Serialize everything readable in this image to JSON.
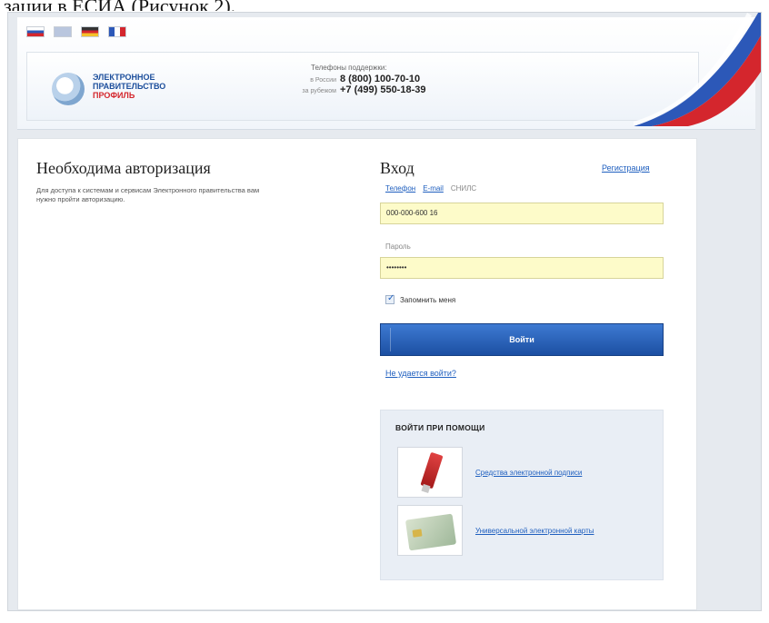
{
  "doc_caption": "зации в ЕСИА (Рисунок 2).",
  "languages": [
    "Русский",
    "English",
    "Deutsch",
    "Français"
  ],
  "brand": {
    "line1": "ЭЛЕКТРОННОЕ",
    "line2": "ПРАВИТЕЛЬСТВО",
    "line3": "ПРОФИЛЬ"
  },
  "support": {
    "title": "Телефоны поддержки:",
    "russia_label": "в России",
    "russia_phone": "8 (800) 100-70-10",
    "abroad_label": "за рубежом",
    "abroad_phone": "+7 (499) 550-18-39"
  },
  "auth_info": {
    "title": "Необходима авторизация",
    "description": "Для доступа к системам и сервисам Электронного правительства вам нужно пройти авторизацию."
  },
  "login": {
    "title": "Вход",
    "register_link": "Регистрация",
    "tabs": [
      {
        "label": "Телефон",
        "active": false
      },
      {
        "label": "E-mail",
        "active": false
      },
      {
        "label": "СНИЛС",
        "active": true
      }
    ],
    "login_value": "000-000-600 16",
    "password_label": "Пароль",
    "password_value": "••••••••",
    "remember_label": "Запомнить меня",
    "remember_checked": true,
    "submit_label": "Войти",
    "forgot_link": "Не удается войти?"
  },
  "alt_login": {
    "title": "ВОЙТИ ПРИ ПОМОЩИ",
    "items": [
      {
        "label": "Средства электронной подписи",
        "icon": "usb-token-icon"
      },
      {
        "label": "Универсальной электронной карты",
        "icon": "smart-card-icon"
      }
    ]
  },
  "colors": {
    "accent_blue": "#1f5fbf",
    "button_blue": "#1c4fa2",
    "input_yellow": "#fdfbc9",
    "brand_red": "#d4262d"
  }
}
